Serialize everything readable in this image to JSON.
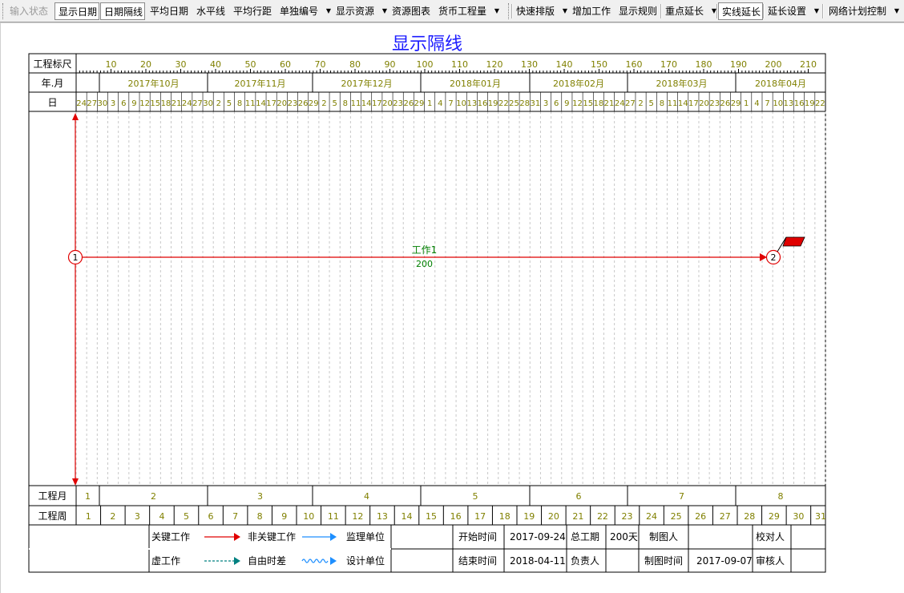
{
  "toolbar": {
    "items": [
      {
        "label": "输入状态",
        "state": "disabled"
      },
      {
        "label": "显示日期",
        "state": "pressed"
      },
      {
        "label": "日期隔线",
        "state": "pressed"
      },
      {
        "label": "平均日期",
        "state": "normal"
      },
      {
        "label": "水平线",
        "state": "normal"
      },
      {
        "label": "平均行距",
        "state": "normal"
      },
      {
        "label": "单独编号",
        "state": "normal",
        "dropdown": true
      },
      {
        "label": "显示资源",
        "state": "normal",
        "dropdown": true
      },
      {
        "label": "资源图表",
        "state": "normal"
      },
      {
        "label": "货币工程量",
        "state": "normal",
        "dropdown": true
      },
      {
        "label": "快速排版",
        "state": "normal",
        "dropdown": true
      },
      {
        "label": "增加工作",
        "state": "normal"
      },
      {
        "label": "显示规则",
        "state": "normal"
      },
      {
        "label": "重点延长",
        "state": "normal",
        "dropdown": true
      },
      {
        "label": "实线延长",
        "state": "pressed"
      },
      {
        "label": "延长设置",
        "state": "normal",
        "dropdown": true
      },
      {
        "label": "网络计划控制",
        "state": "normal",
        "dropdown": true
      }
    ]
  },
  "title": "显示隔线",
  "colors": {
    "title": "#1a1aff",
    "header_text": "#808000",
    "critical": "#e00000",
    "noncritical": "#1e8fff",
    "free_float": "#008080",
    "activity_text": "#008000",
    "grid": "#c8c8c8"
  },
  "header": {
    "scale_label": "工程标尺",
    "month_row_label": "年.月",
    "day_row_label": "日",
    "scale_ticks": [
      "10",
      "20",
      "30",
      "40",
      "50",
      "60",
      "70",
      "80",
      "90",
      "100",
      "110",
      "120",
      "130",
      "140",
      "150",
      "160",
      "170",
      "180",
      "190",
      "200",
      "210"
    ],
    "months": [
      "2017年10月",
      "2017年11月",
      "2017年12月",
      "2018年01月",
      "2018年02月",
      "2018年03月",
      "2018年04月"
    ],
    "days": [
      "24",
      "27",
      "30",
      "3",
      "6",
      "9",
      "12",
      "15",
      "18",
      "21",
      "24",
      "27",
      "30",
      "2",
      "5",
      "8",
      "11",
      "14",
      "17",
      "20",
      "23",
      "26",
      "29",
      "2",
      "5",
      "8",
      "11",
      "14",
      "17",
      "20",
      "23",
      "26",
      "29",
      "1",
      "4",
      "7",
      "10",
      "13",
      "16",
      "19",
      "22",
      "25",
      "28",
      "31",
      "3",
      "6",
      "9",
      "12",
      "15",
      "18",
      "21",
      "24",
      "27",
      "2",
      "5",
      "8",
      "11",
      "14",
      "17",
      "20",
      "23",
      "26",
      "29",
      "1",
      "4",
      "7",
      "10",
      "13",
      "16",
      "19",
      "22"
    ]
  },
  "footer": {
    "month_row_label": "工程月",
    "week_row_label": "工程周",
    "project_months": [
      "1",
      "2",
      "3",
      "4",
      "5",
      "6",
      "7",
      "8"
    ],
    "project_weeks": [
      "1",
      "2",
      "3",
      "4",
      "5",
      "6",
      "7",
      "8",
      "9",
      "10",
      "11",
      "12",
      "13",
      "14",
      "15",
      "16",
      "17",
      "18",
      "19",
      "20",
      "21",
      "22",
      "23",
      "24",
      "25",
      "26",
      "27",
      "28",
      "29",
      "30",
      "31"
    ]
  },
  "network": {
    "nodes": [
      {
        "id": "1"
      },
      {
        "id": "2"
      }
    ],
    "activities": [
      {
        "name": "工作1",
        "duration": "200",
        "from": "1",
        "to": "2",
        "critical": true
      }
    ]
  },
  "legend": {
    "critical_work": "关键工作",
    "noncritical_work": "非关键工作",
    "dummy_work": "虚工作",
    "free_float": "自由时差",
    "supervisor_unit": "监理单位",
    "design_unit": "设计单位",
    "start_time_label": "开始时间",
    "start_time_value": "2017-09-24",
    "end_time_label": "结束时间",
    "end_time_value": "2018-04-11",
    "total_duration_label": "总工期",
    "total_duration_value": "200天",
    "responsible_label": "负责人",
    "drawer_label": "制图人",
    "draw_time_label": "制图时间",
    "draw_time_value": "2017-09-07",
    "proofreader_label": "校对人",
    "reviewer_label": "审核人"
  }
}
